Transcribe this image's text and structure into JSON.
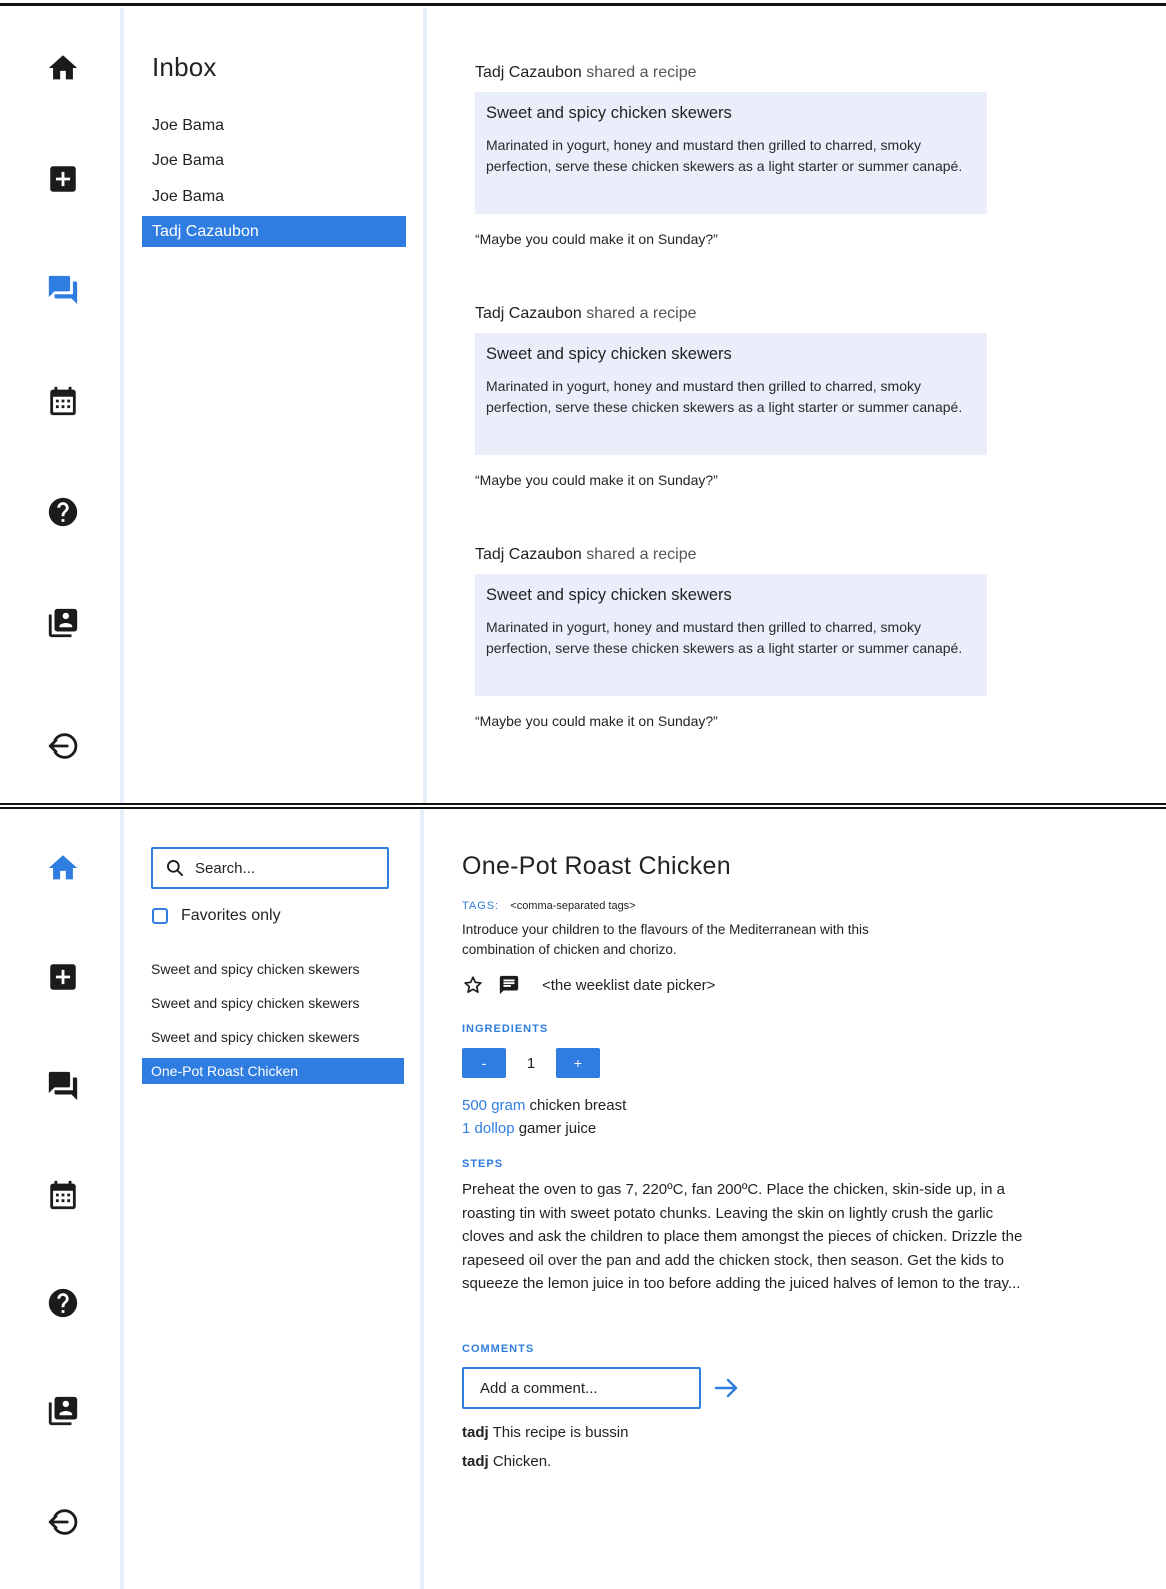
{
  "top": {
    "inbox": {
      "title": "Inbox",
      "threads": [
        "Joe Bama",
        "Joe Bama",
        "Joe Bama",
        "Tadj Cazaubon"
      ]
    },
    "messages": [
      {
        "sender": "Tadj Cazaubon",
        "action": "shared a recipe",
        "recipe_title": "Sweet and spicy chicken skewers",
        "recipe_desc": "Marinated in yogurt, honey and mustard then grilled to charred, smoky perfection, serve these chicken skewers as a light starter or summer canapé.",
        "quote": "“Maybe you could make it on Sunday?”"
      },
      {
        "sender": "Tadj Cazaubon",
        "action": "shared a recipe",
        "recipe_title": "Sweet and spicy chicken skewers",
        "recipe_desc": "Marinated in yogurt, honey and mustard then grilled to charred, smoky perfection, serve these chicken skewers as a light starter or summer canapé.",
        "quote": "“Maybe you could make it on Sunday?”"
      },
      {
        "sender": "Tadj Cazaubon",
        "action": "shared a recipe",
        "recipe_title": "Sweet and spicy chicken skewers",
        "recipe_desc": "Marinated in yogurt, honey and mustard then grilled to charred, smoky perfection, serve these chicken skewers as a light starter or summer canapé.",
        "quote": "“Maybe you could make it on Sunday?”"
      }
    ]
  },
  "bottom": {
    "search": {
      "placeholder": "Search..."
    },
    "favorites_label": "Favorites only",
    "recipes": [
      "Sweet and spicy chicken skewers",
      "Sweet and spicy chicken skewers",
      "Sweet and spicy chicken skewers",
      "One-Pot Roast Chicken"
    ],
    "recipe": {
      "title": "One-Pot Roast Chicken",
      "tags_label": "TAGS:",
      "tags_value": "<comma-separated tags>",
      "description": "Introduce your children to the flavours of the Mediterranean with this combination of chicken and chorizo.",
      "date_picker": "<the weeklist date picker>",
      "ingredients_label": "INGREDIENTS",
      "servings": "1",
      "minus_label": "-",
      "plus_label": "+",
      "ingredients": [
        {
          "qty": "500 gram",
          "name": "chicken breast"
        },
        {
          "qty": "1 dollop",
          "name": "gamer juice"
        }
      ],
      "steps_label": "STEPS",
      "steps": "Preheat the oven to gas 7, 220ºC, fan 200ºC. Place the chicken, skin-side up, in a roasting tin with sweet potato chunks. Leaving the skin on lightly crush the garlic cloves and ask the children to place them amongst the pieces of chicken. Drizzle the rapeseed oil over the pan and add the chicken stock, then season. Get the kids to squeeze  the lemon juice in too before adding the juiced halves of lemon to the tray...",
      "comments_label": "COMMENTS",
      "comment_placeholder": "Add a comment...",
      "comments": [
        {
          "user": "tadj",
          "text": "This recipe is bussin"
        },
        {
          "user": "tadj",
          "text": "Chicken."
        }
      ]
    }
  },
  "colors": {
    "accent": "#2f7de1",
    "card_bg": "#e9eefa",
    "separator": "#e8edfb",
    "icon": "#1b1b1b"
  },
  "icons": [
    "home-icon",
    "add-box-icon",
    "chat-icon",
    "calendar-icon",
    "help-icon",
    "contacts-icon",
    "logout-icon"
  ]
}
